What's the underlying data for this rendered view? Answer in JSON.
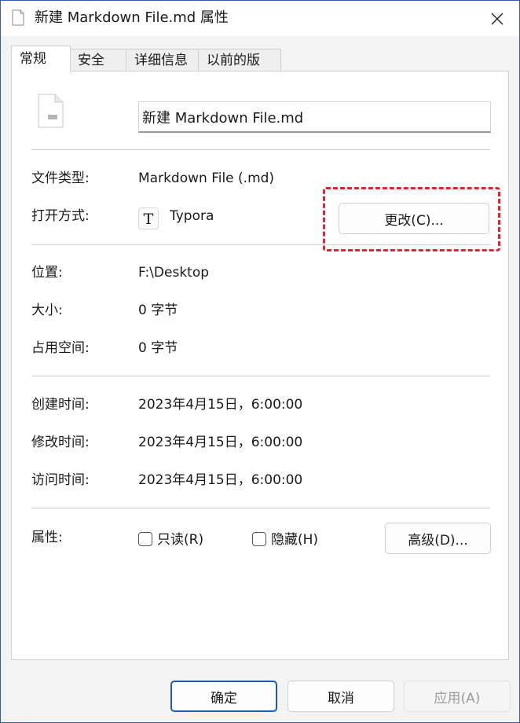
{
  "window": {
    "title": "新建 Markdown File.md 属性"
  },
  "tabs": [
    {
      "label": "常规",
      "active": true
    },
    {
      "label": "安全"
    },
    {
      "label": "详细信息"
    },
    {
      "label": "以前的版本"
    }
  ],
  "general": {
    "file_name": "新建 Markdown File.md",
    "type_label": "文件类型:",
    "type_value": "Markdown File (.md)",
    "open_with_label": "打开方式:",
    "open_with_value": "Typora",
    "open_with_icon_glyph": "T",
    "change_button": "更改(C)...",
    "location_label": "位置:",
    "location_value": "F:\\Desktop",
    "size_label": "大小:",
    "size_value": "0 字节",
    "size_on_disk_label": "占用空间:",
    "size_on_disk_value": "0 字节",
    "created_label": "创建时间:",
    "created_value": "2023年4月15日，6:00:00",
    "modified_label": "修改时间:",
    "modified_value": "2023年4月15日，6:00:00",
    "accessed_label": "访问时间:",
    "accessed_value": "2023年4月15日，6:00:00",
    "attributes_label": "属性:",
    "readonly_label": "只读(R)",
    "hidden_label": "隐藏(H)",
    "advanced_button": "高级(D)..."
  },
  "footer": {
    "ok": "确定",
    "cancel": "取消",
    "apply": "应用(A)"
  },
  "colors": {
    "accent": "#1f5ca8",
    "highlight": "#e1242d"
  }
}
